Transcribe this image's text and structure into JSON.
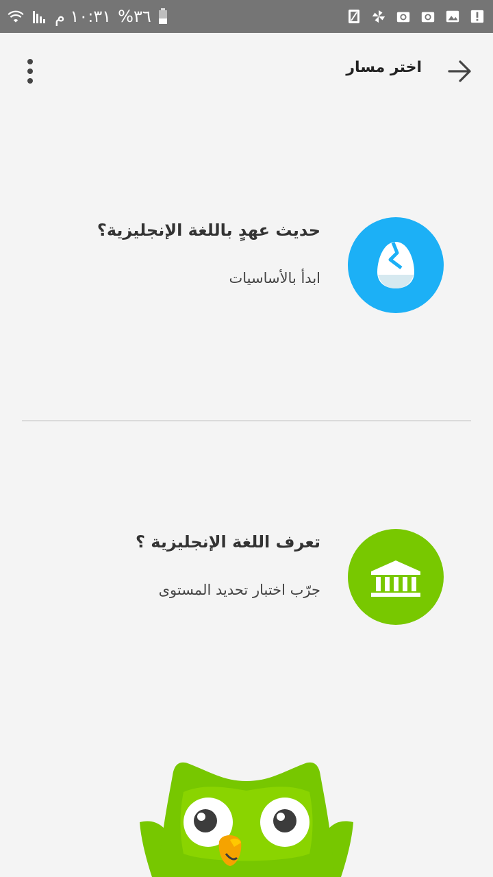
{
  "status_bar": {
    "time": "١٠:٣١ م",
    "battery_percent": "%٣٦",
    "icons": [
      "battery-icon",
      "signal-icon",
      "wifi-icon",
      "sim-icon",
      "pinwheel-icon",
      "email-icon",
      "email-icon",
      "image-icon",
      "alert-icon"
    ]
  },
  "app_bar": {
    "title": "اختر مسار",
    "back_icon": "arrow-right-icon",
    "menu_icon": "more-vert-icon"
  },
  "options": [
    {
      "title": "حديث عهدٍ باللغة الإنجليزية؟",
      "subtitle": "ابدأ بالأساسيات",
      "icon": "egg-icon",
      "color": "#1cb0f6"
    },
    {
      "title": "تعرف اللغة الإنجليزية ؟",
      "subtitle": "جرّب اختبار تحديد المستوى",
      "icon": "bank-icon",
      "color": "#78c800"
    }
  ],
  "colors": {
    "background": "#f4f4f4",
    "status_bar": "#757575",
    "owl_green": "#77c700"
  }
}
